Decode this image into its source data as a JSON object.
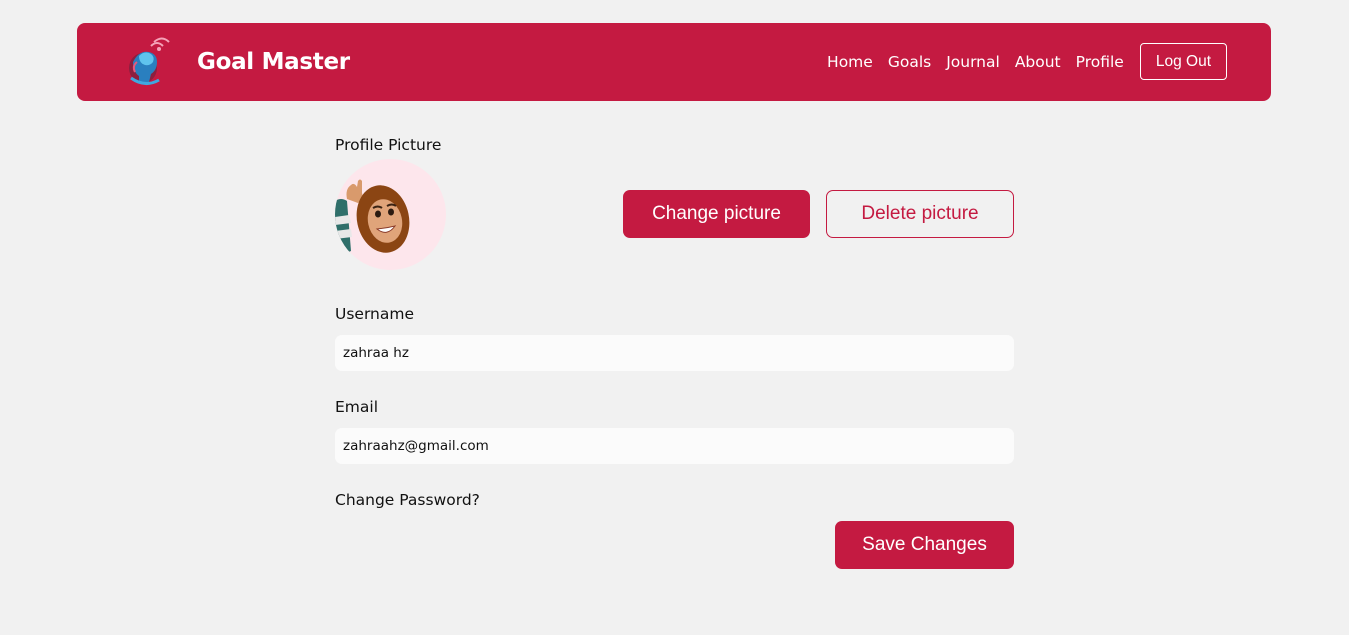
{
  "header": {
    "brand": "Goal Master",
    "nav": [
      "Home",
      "Goals",
      "Journal",
      "About",
      "Profile"
    ],
    "logout_label": "Log Out"
  },
  "profile": {
    "picture_label": "Profile Picture",
    "change_picture_label": "Change picture",
    "delete_picture_label": "Delete picture",
    "username_label": "Username",
    "username_value": "zahraa hz",
    "email_label": "Email",
    "email_value": "zahraahz@gmail.com",
    "change_password_label": "Change Password?",
    "save_label": "Save Changes"
  },
  "colors": {
    "brand": "#c41a41",
    "page_bg": "#f1f1f1",
    "avatar_bg": "#fde6ec"
  },
  "icons": {
    "logo": "brain-head-logo-icon",
    "avatar": "waving-avatar-image"
  }
}
